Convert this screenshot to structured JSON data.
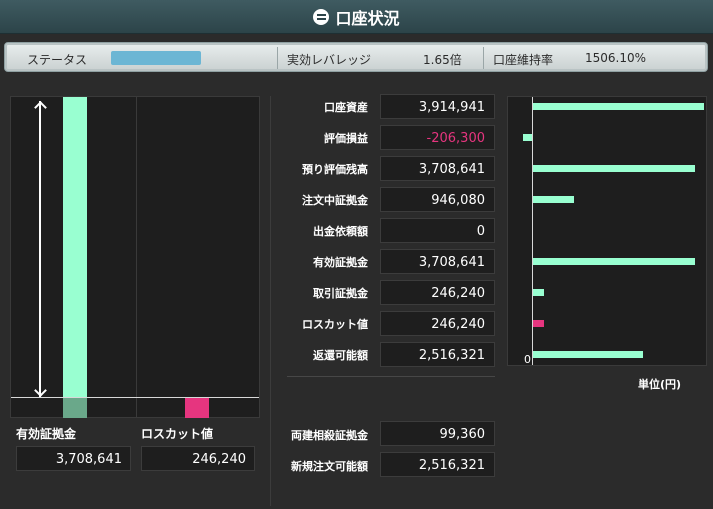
{
  "title": "口座状況",
  "colors": {
    "positive_bar": "#99ffd1",
    "negative_bar": "#e6357f",
    "negative_text": "#e6357f",
    "status_bar": "#6cb6d4"
  },
  "status": {
    "label": "ステータス",
    "leverage_label": "実効レバレッジ",
    "leverage_value": "1.65倍",
    "margin_ratio_label": "口座維持率",
    "margin_ratio_value": "1506.10%"
  },
  "gauge": {
    "effective_margin_label": "有効証拠金",
    "effective_margin_value": "3,708,641",
    "losscut_label": "ロスカット値",
    "losscut_value": "246,240"
  },
  "rows": [
    {
      "label": "口座資産",
      "value": "3,914,941",
      "negative": false
    },
    {
      "label": "評価損益",
      "value": "-206,300",
      "negative": true
    },
    {
      "label": "預り評価残高",
      "value": "3,708,641",
      "negative": false
    },
    {
      "label": "注文中証拠金",
      "value": "946,080",
      "negative": false
    },
    {
      "label": "出金依頼額",
      "value": "0",
      "negative": false
    },
    {
      "label": "有効証拠金",
      "value": "3,708,641",
      "negative": false
    },
    {
      "label": "取引証拠金",
      "value": "246,240",
      "negative": false
    },
    {
      "label": "ロスカット値",
      "value": "246,240",
      "negative": false
    },
    {
      "label": "返還可能額",
      "value": "2,516,321",
      "negative": false
    }
  ],
  "bottom_rows": [
    {
      "label": "両建相殺証拠金",
      "value": "99,360"
    },
    {
      "label": "新規注文可能額",
      "value": "2,516,321"
    }
  ],
  "chart_data": {
    "type": "bar",
    "orientation": "horizontal",
    "categories": [
      "口座資産",
      "評価損益",
      "預り評価残高",
      "注文中証拠金",
      "出金依頼額",
      "有効証拠金",
      "取引証拠金",
      "ロスカット値",
      "返還可能額"
    ],
    "values": [
      3914941,
      -206300,
      3708641,
      946080,
      0,
      3708641,
      246240,
      246240,
      2516321
    ],
    "bar_colors": [
      "#99ffd1",
      "#99ffd1",
      "#99ffd1",
      "#99ffd1",
      "#99ffd1",
      "#99ffd1",
      "#99ffd1",
      "#e6357f",
      "#99ffd1"
    ],
    "zero_label": "0",
    "unit_label": "単位(円)"
  }
}
